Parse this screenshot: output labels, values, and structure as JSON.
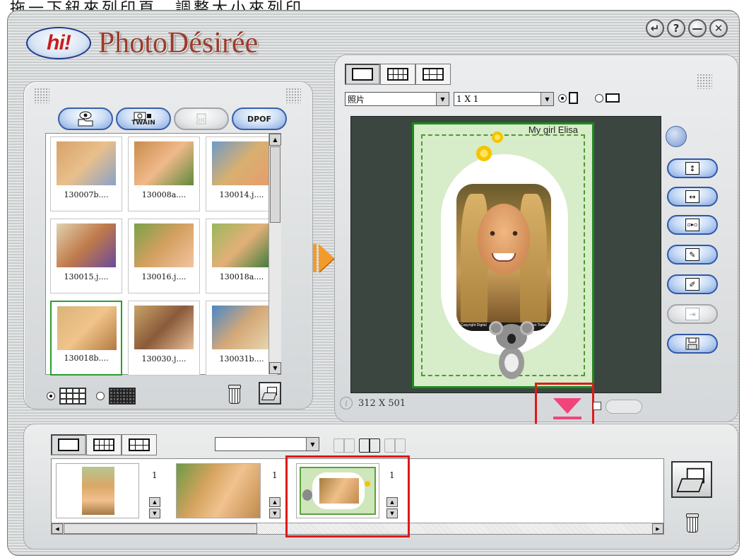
{
  "caption_partial": "拖一下鈕來列印頁、調整大小來列印",
  "logo": {
    "hi_text": "hi!",
    "name": "PhotoDésirée"
  },
  "window_buttons": [
    "↵",
    "?",
    "—",
    "✕"
  ],
  "source_buttons": {
    "open_label": "",
    "twain_label": "TWAIN",
    "disabled_label": "",
    "dpof_label": "DPOF"
  },
  "thumbnails": [
    {
      "caption": "130007b...."
    },
    {
      "caption": "130008a...."
    },
    {
      "caption": "130014.j...."
    },
    {
      "caption": "130015.j...."
    },
    {
      "caption": "130016.j...."
    },
    {
      "caption": "130018a...."
    },
    {
      "caption": "130018b...."
    },
    {
      "caption": "130030.j...."
    },
    {
      "caption": "130031b...."
    }
  ],
  "preview": {
    "paper_type": "照片",
    "layout": "1 X 1",
    "page_title": "My girl Elisa",
    "copyright": "Copyright Digital",
    "credit": "Families Today",
    "dimensions": "312 X 501"
  },
  "bottom": {
    "combo_value": "",
    "tray_items": [
      {
        "count": "1"
      },
      {
        "count": "1"
      },
      {
        "count": "1"
      }
    ]
  },
  "colors": {
    "accent_blue": "#2f58a8",
    "orange_arrow": "#f29b2a",
    "pink_arrow": "#f0447a",
    "highlight_red": "#e01818",
    "canvas_bg": "#3b4641",
    "page_bg": "#d7ecc9"
  }
}
